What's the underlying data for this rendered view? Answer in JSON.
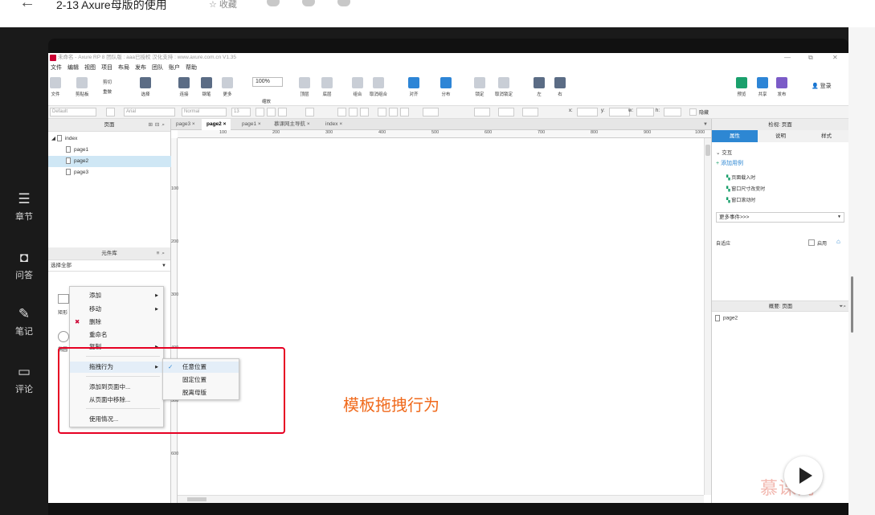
{
  "header": {
    "back_icon": "arrow-left-icon",
    "title": "2-13 Axure母版的使用",
    "favorite": "☆ 收藏",
    "share_icons": [
      "wechat-icon",
      "qq-icon",
      "weibo-icon"
    ]
  },
  "sidebar": [
    {
      "icon": "chapters-icon",
      "label": "章节"
    },
    {
      "icon": "qa-icon",
      "label": "问答"
    },
    {
      "icon": "note-icon",
      "label": "笔记"
    },
    {
      "icon": "comment-icon",
      "label": "评论"
    }
  ],
  "app": {
    "title": "未命名 - Axure RP 8 团队版 : aaa已授权 汉化支持 : www.axure.com.cn V1.35",
    "menus": [
      "文件",
      "编辑",
      "视图",
      "项目",
      "布局",
      "发布",
      "团队",
      "账户",
      "帮助"
    ],
    "toolbar": {
      "items": [
        "文件",
        "剪贴板",
        "选择",
        "连接",
        "钢笔",
        "更多",
        "缩放",
        "顶层",
        "底层",
        "组合",
        "取消组合",
        "对齐",
        "分布",
        "锁定",
        "取消锁定",
        "左",
        "右",
        "预览",
        "共享",
        "发布"
      ],
      "cut": "剪切",
      "redo": "重做",
      "zoom": "100%",
      "login": "登录"
    },
    "stylebar": {
      "style": "Default",
      "font": "Arial",
      "weight": "Normal",
      "size": "13",
      "x_label": "x:",
      "y_label": "y:",
      "w_label": "w:",
      "h_label": "h:",
      "hidden": "隐藏"
    },
    "pages_panel": {
      "title": "页面",
      "root": "index",
      "pages": [
        "page1",
        "page2",
        "page3"
      ],
      "selected": "page2"
    },
    "library_panel": {
      "title": "元件库",
      "select_all": "选择全部",
      "stub1": "矩形",
      "stub2": "椭圆"
    },
    "tabs": [
      {
        "label": "page3",
        "close": "×"
      },
      {
        "label": "page2",
        "close": "×",
        "active": true
      },
      {
        "label": "page1",
        "close": "×"
      },
      {
        "label": "慕课网主导航",
        "close": "×"
      },
      {
        "label": "index",
        "close": "×"
      }
    ],
    "ruler_h": [
      "100",
      "200",
      "300",
      "400",
      "500",
      "600",
      "700",
      "800",
      "900",
      "1000"
    ],
    "ruler_v": [
      "100",
      "200",
      "300",
      "400",
      "500",
      "600"
    ],
    "inspector": {
      "title": "检视: 页面",
      "tabs": [
        "属性",
        "说明",
        "样式"
      ],
      "interaction": "交互",
      "add_case": "添加用例",
      "events": [
        "页面载入时",
        "窗口尺寸改变时",
        "窗口滚动时"
      ],
      "more_events": "更多事件>>>",
      "adaptive": "自适应",
      "enable": "启用"
    },
    "outline": {
      "title": "概要: 页面",
      "page": "page2"
    }
  },
  "context_menu": {
    "items": [
      "添加",
      "移动",
      "删除",
      "重命名",
      "复制",
      "拖拽行为",
      "添加到页面中...",
      "从页面中移除...",
      "使用情况..."
    ]
  },
  "submenu": {
    "items": [
      "任意位置",
      "固定位置",
      "脱离母版"
    ],
    "checked": "任意位置",
    "check": "✓"
  },
  "annotation": "模板拖拽行为",
  "watermark": "慕课网",
  "accent_color": "#2d87d3",
  "annotation_color": "#f06a1c",
  "highlight_color": "#e60023"
}
